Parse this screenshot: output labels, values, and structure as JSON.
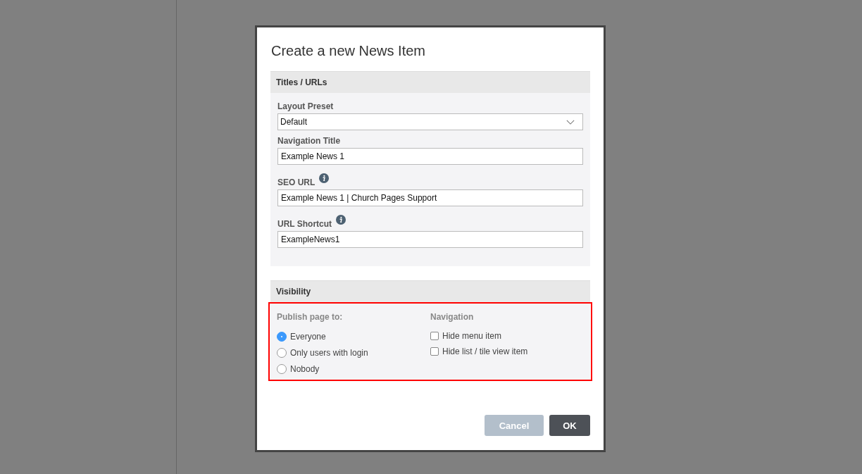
{
  "dialog": {
    "title": "Create a new News Item"
  },
  "titles_section": {
    "heading": "Titles / URLs",
    "fields": [
      {
        "label": "Layout Preset",
        "kind": "select",
        "value": "Default",
        "info": false
      },
      {
        "label": "Navigation Title",
        "kind": "text",
        "value": "Example News 1",
        "info": false
      },
      {
        "label": "SEO URL",
        "kind": "text",
        "value": "Example News 1 | Church Pages Support",
        "info": true
      },
      {
        "label": "URL Shortcut",
        "kind": "text",
        "value": "ExampleNews1",
        "info": true
      }
    ]
  },
  "visibility_section": {
    "heading": "Visibility",
    "publish": {
      "label": "Publish page to:",
      "options": [
        {
          "label": "Everyone",
          "selected": true
        },
        {
          "label": "Only users with login",
          "selected": false
        },
        {
          "label": "Nobody",
          "selected": false
        }
      ]
    },
    "navigation": {
      "label": "Navigation",
      "options": [
        {
          "label": "Hide menu item",
          "checked": false
        },
        {
          "label": "Hide list / tile view item",
          "checked": false
        }
      ]
    }
  },
  "buttons": [
    {
      "label": "Cancel",
      "kind": "secondary"
    },
    {
      "label": "OK",
      "kind": "primary"
    }
  ]
}
